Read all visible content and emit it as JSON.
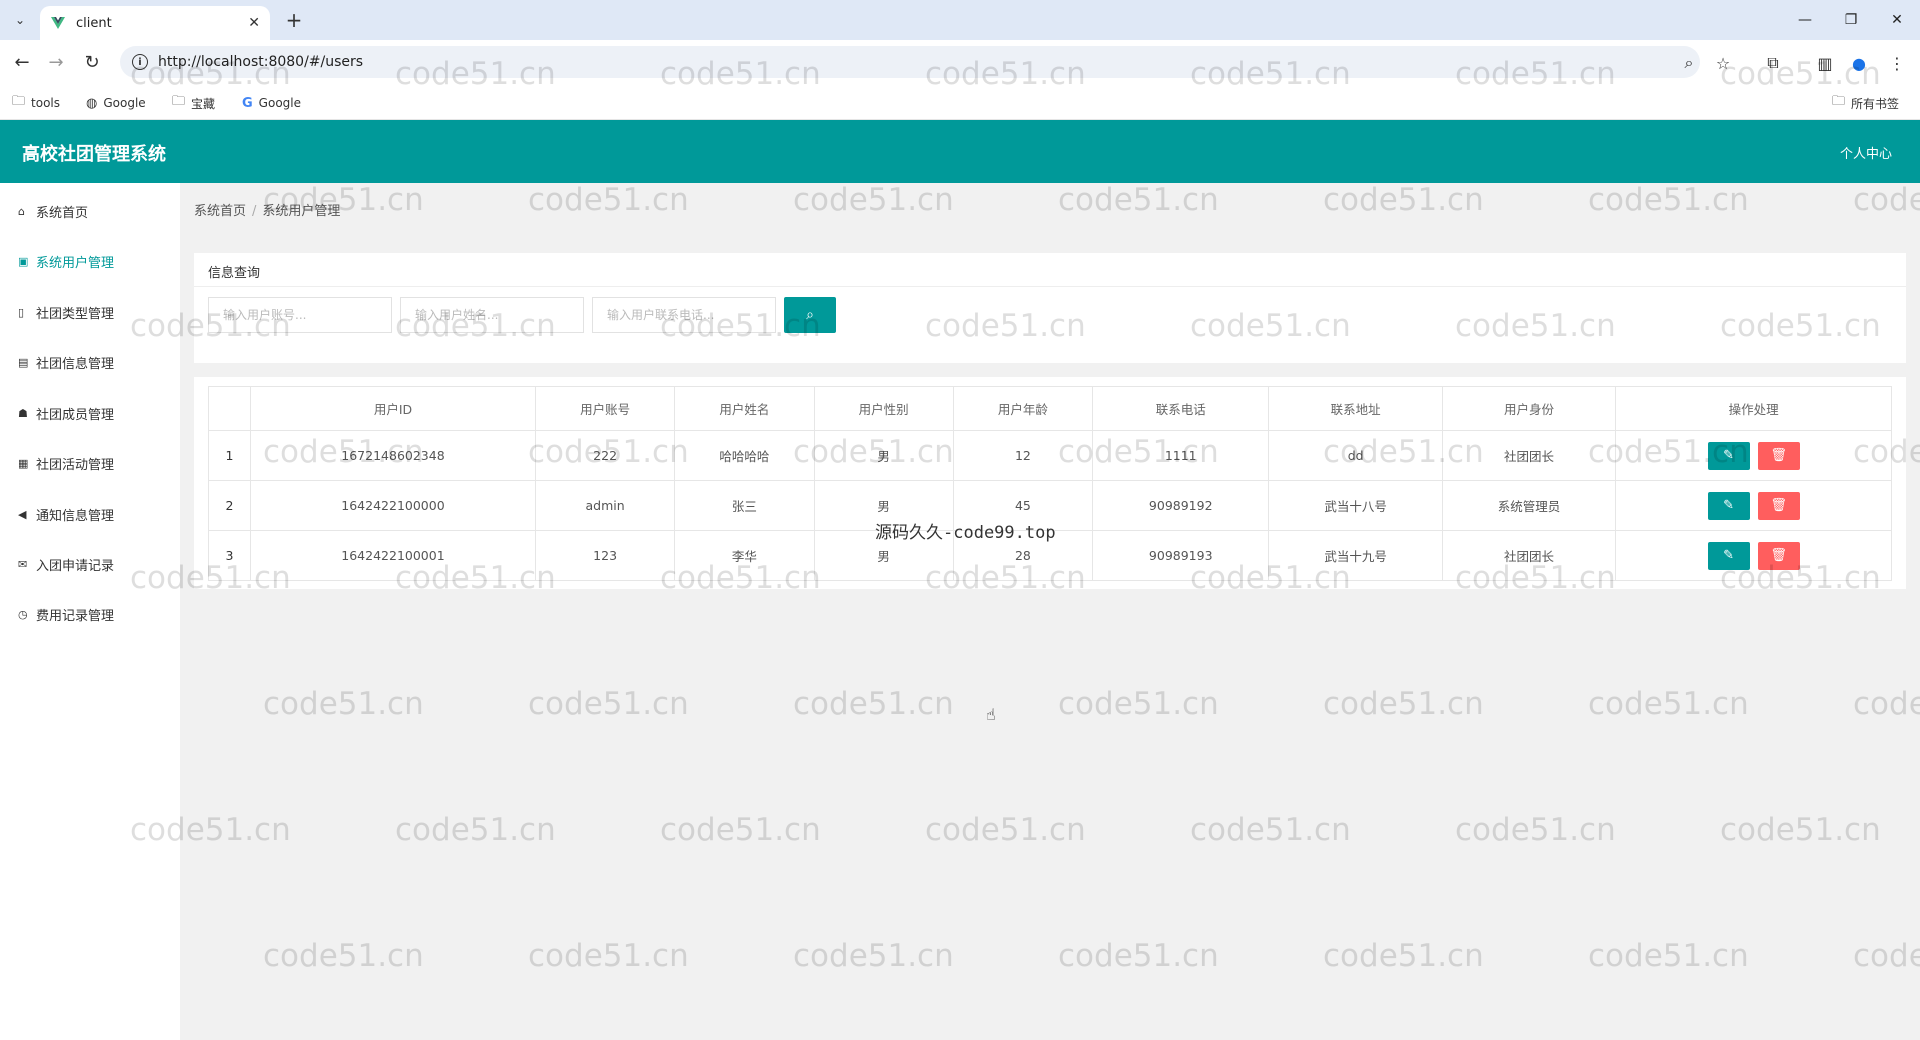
{
  "browser": {
    "tab_title": "client",
    "url": "http://localhost:8080/#/users",
    "new_tab": "+",
    "bookmarks": [
      {
        "label": "tools",
        "icon": "folder-icon"
      },
      {
        "label": "Google",
        "icon": "globe-icon"
      },
      {
        "label": "宝藏",
        "icon": "folder-icon"
      },
      {
        "label": "Google",
        "icon": "google-icon"
      }
    ],
    "all_bookmarks": "所有书签"
  },
  "app": {
    "title": "高校社团管理系统",
    "user_center": "个人中心",
    "accent_color": "#009999",
    "danger_color": "#ff5e5e"
  },
  "sidebar": {
    "items": [
      {
        "label": "系统首页",
        "icon": "home-icon"
      },
      {
        "label": "系统用户管理",
        "icon": "user-card-icon",
        "active": true
      },
      {
        "label": "社团类型管理",
        "icon": "document-icon"
      },
      {
        "label": "社团信息管理",
        "icon": "bus-icon"
      },
      {
        "label": "社团成员管理",
        "icon": "users-icon"
      },
      {
        "label": "社团活动管理",
        "icon": "calendar-icon"
      },
      {
        "label": "通知信息管理",
        "icon": "megaphone-icon"
      },
      {
        "label": "入团申请记录",
        "icon": "envelope-icon"
      },
      {
        "label": "费用记录管理",
        "icon": "clock-icon"
      }
    ]
  },
  "breadcrumb": {
    "home": "系统首页",
    "sep": "/",
    "current": "系统用户管理"
  },
  "query": {
    "title": "信息查询",
    "account_placeholder": "输入用户账号...",
    "name_placeholder": "输入用户姓名...",
    "phone_placeholder": "输入用户联系电话..."
  },
  "table": {
    "headers": [
      "",
      "用户ID",
      "用户账号",
      "用户姓名",
      "用户性别",
      "用户年龄",
      "联系电话",
      "联系地址",
      "用户身份",
      "操作处理"
    ],
    "rows": [
      {
        "no": "1",
        "id": "1672148602348",
        "account": "222",
        "name": "哈哈哈哈",
        "gender": "男",
        "age": "12",
        "phone": "1111",
        "address": "dd",
        "role": "社团团长"
      },
      {
        "no": "2",
        "id": "1642422100000",
        "account": "admin",
        "name": "张三",
        "gender": "男",
        "age": "45",
        "phone": "90989192",
        "address": "武当十八号",
        "role": "系统管理员"
      },
      {
        "no": "3",
        "id": "1642422100001",
        "account": "123",
        "name": "李华",
        "gender": "男",
        "age": "28",
        "phone": "90989193",
        "address": "武当十九号",
        "role": "社团团长"
      }
    ]
  },
  "watermark": "code51.cn",
  "center_mark": "源码久久-code99.top"
}
